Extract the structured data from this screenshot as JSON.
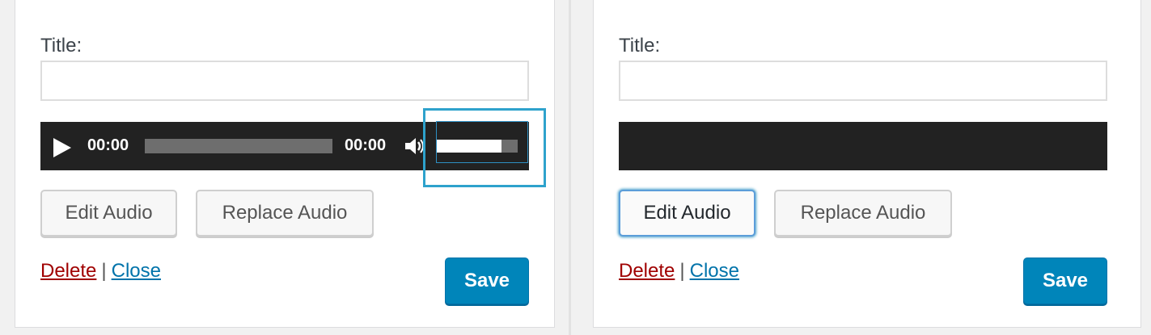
{
  "left_panel": {
    "title_label": "Title:",
    "title_value": "",
    "player": {
      "current_time": "00:00",
      "duration": "00:00",
      "play_icon": "play-icon",
      "mute_icon": "speaker-icon",
      "volume_level": 0.8
    },
    "edit_button": "Edit Audio",
    "replace_button": "Replace Audio",
    "delete_link": "Delete",
    "separator": "|",
    "close_link": "Close",
    "save_button": "Save"
  },
  "right_panel": {
    "title_label": "Title:",
    "title_value": "",
    "edit_button": "Edit Audio",
    "replace_button": "Replace Audio",
    "delete_link": "Delete",
    "separator": "|",
    "close_link": "Close",
    "save_button": "Save"
  },
  "colors": {
    "player_background": "#222222",
    "highlight": "#2ea2cc",
    "delete_link": "#a00000",
    "close_link": "#0073aa",
    "save_button": "#0085ba"
  }
}
